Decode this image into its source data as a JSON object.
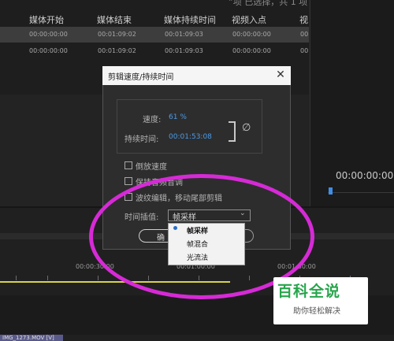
{
  "project": {
    "header_cut": "“项 已选择，共 1 项",
    "columns": [
      "媒体开始",
      "媒体结束",
      "媒体持续时间",
      "视频入点",
      "视"
    ],
    "rows": [
      [
        "00:00:00:00",
        "00:01:09:02",
        "00:01:09:03",
        "00:00:00:00",
        "00"
      ],
      [
        "00:00:00:00",
        "00:01:09:02",
        "00:01:09:03",
        "00:00:00:00",
        "00"
      ]
    ]
  },
  "program_monitor": {
    "timecode": "00:00:00:00"
  },
  "timeline": {
    "ticks": [
      "00:00:30:00",
      "00:01:00:00",
      "00:01:30:00"
    ],
    "clip_label": "IMG_1273.MOV [V]"
  },
  "dialog": {
    "title": "剪辑速度/持续时间",
    "close_glyph": "✕",
    "speed_label": "速度:",
    "speed_value": "61 %",
    "duration_label": "持续时间:",
    "duration_value": "00:01:53:08",
    "link_glyph": "∅",
    "checkboxes": [
      "倒放速度",
      "保持音频音调",
      "波纹编辑，移动尾部剪辑"
    ],
    "interp_label": "时间插值:",
    "interp_value": "帧采样",
    "ok_label": "确"
  },
  "dropdown": {
    "options": [
      "帧采样",
      "帧混合",
      "光流法"
    ],
    "selected": "帧采样"
  },
  "watermark": {
    "title": "百科全说",
    "subtitle": "助你轻松解决"
  },
  "colors": {
    "accent_blue": "#4c9be8",
    "annotation": "#d62ad6",
    "watermark_green": "#27a54c",
    "playhead_yellow": "#d8d34a"
  }
}
